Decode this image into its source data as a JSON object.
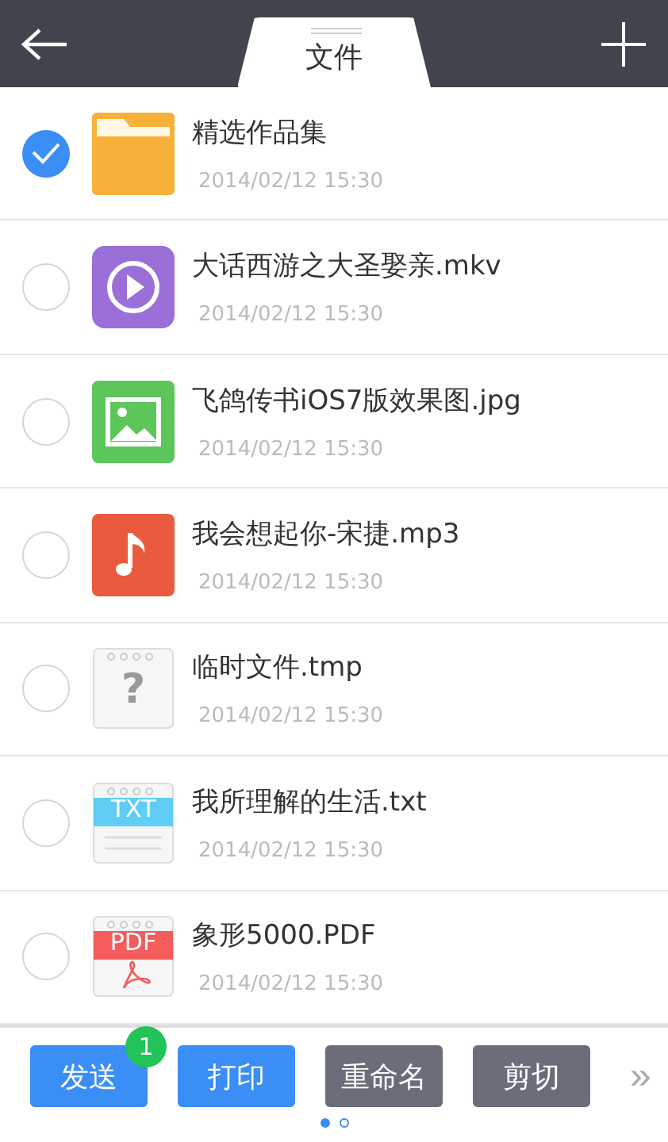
{
  "header": {
    "title": "文件"
  },
  "files": [
    {
      "name": "精选作品集",
      "date": "2014/02/12 15:30",
      "kind": "folder",
      "checked": true
    },
    {
      "name": "大话西游之大圣娶亲.mkv",
      "date": "2014/02/12 15:30",
      "kind": "video",
      "checked": false
    },
    {
      "name": "飞鸽传书iOS7版效果图.jpg",
      "date": "2014/02/12 15:30",
      "kind": "image",
      "checked": false
    },
    {
      "name": "我会想起你-宋捷.mp3",
      "date": "2014/02/12 15:30",
      "kind": "music",
      "checked": false
    },
    {
      "name": "临时文件.tmp",
      "date": "2014/02/12 15:30",
      "kind": "unknown",
      "badge": "?",
      "checked": false
    },
    {
      "name": "我所理解的生活.txt",
      "date": "2014/02/12 15:30",
      "kind": "text",
      "badge": "TXT",
      "checked": false
    },
    {
      "name": "象形5000.PDF",
      "date": "2014/02/12 15:30",
      "kind": "pdf",
      "badge": "PDF",
      "checked": false
    }
  ],
  "actions": [
    {
      "label": "发送",
      "enabled": true,
      "count": "1"
    },
    {
      "label": "打印",
      "enabled": true
    },
    {
      "label": "重命名",
      "enabled": false
    },
    {
      "label": "剪切",
      "enabled": false
    }
  ],
  "more": "»",
  "pages": [
    {
      "selected": true
    },
    {
      "selected": false
    }
  ]
}
